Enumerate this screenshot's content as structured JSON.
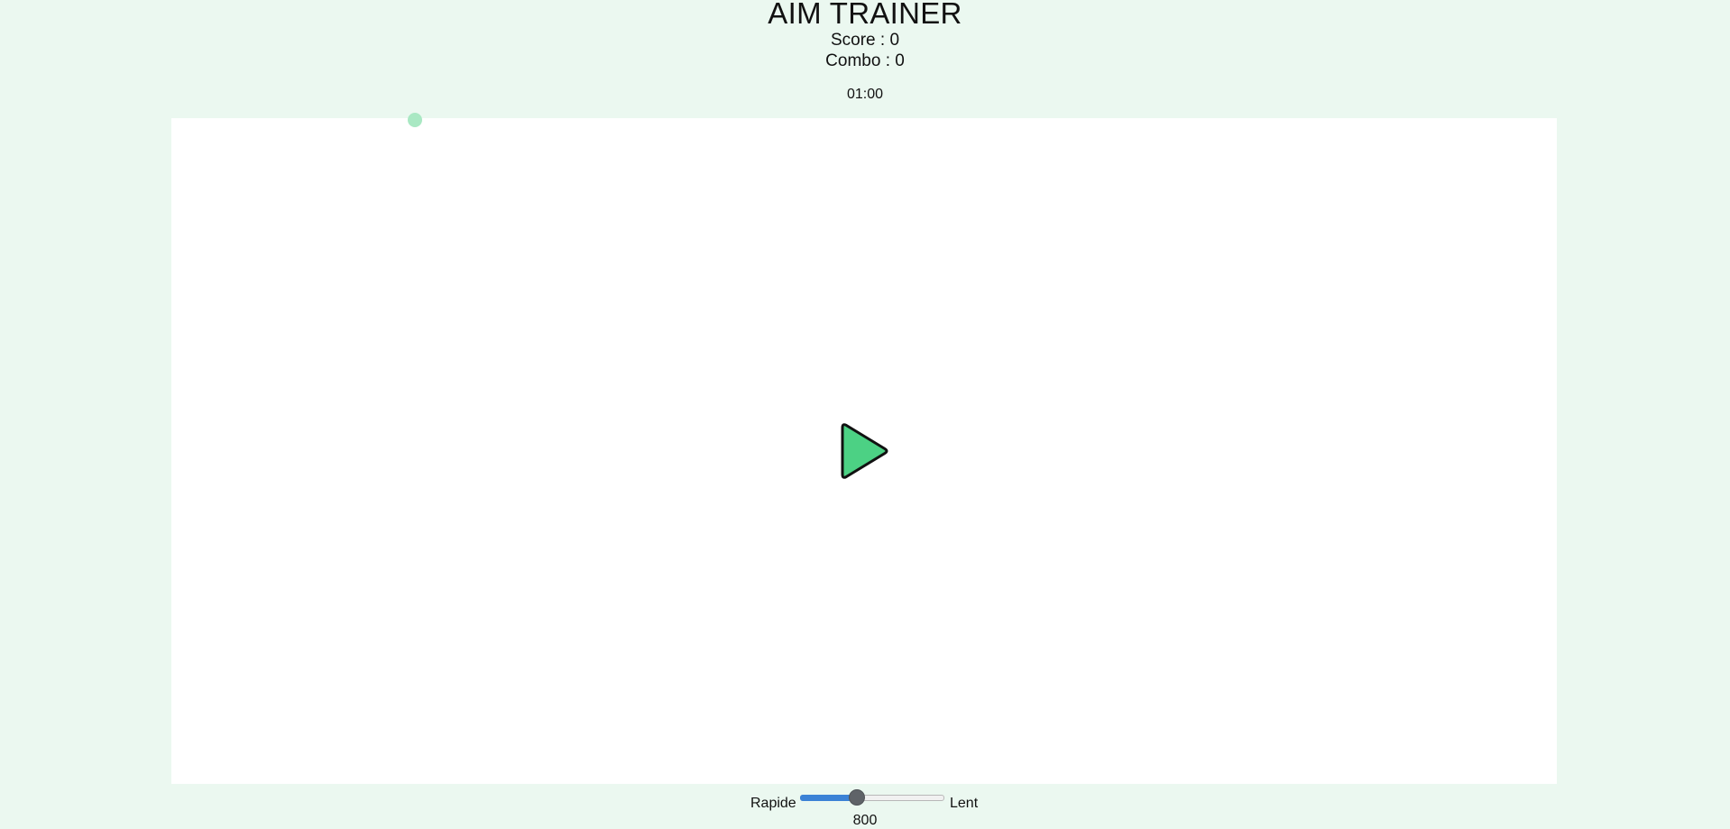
{
  "app": {
    "title": "AIM TRAINER"
  },
  "stats": {
    "score_text": "Score : 0",
    "combo_text": "Combo : 0",
    "timer": "01:00"
  },
  "game": {
    "play_icon": "play-icon",
    "target_color": "#a9e8c3",
    "play_color": "#4cd184",
    "background": "#ffffff"
  },
  "controls": {
    "fast_label": "Rapide",
    "slow_label": "Lent",
    "speed_value": "800",
    "speed_fraction": 0.38
  },
  "colors": {
    "page_bg": "#ebf8f0",
    "slider_accent": "#3b82d6"
  }
}
